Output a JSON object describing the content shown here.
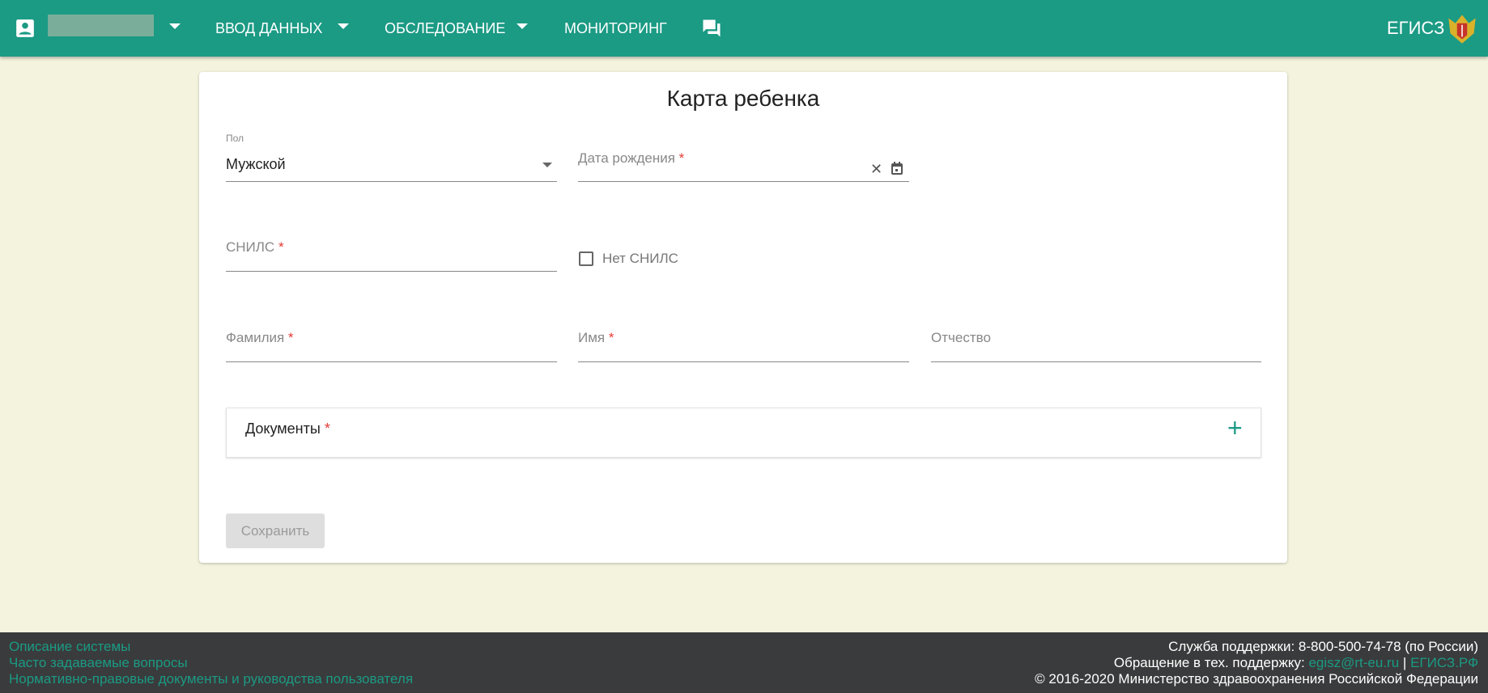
{
  "header": {
    "nav": [
      {
        "label": "ВВОД ДАННЫХ"
      },
      {
        "label": "ОБСЛЕДОВАНИЕ"
      },
      {
        "label": "МОНИТОРИНГ"
      }
    ],
    "brand": "ЕГИСЗ"
  },
  "form": {
    "title": "Карта ребенка",
    "gender": {
      "label": "Пол",
      "value": "Мужской"
    },
    "birth_date": {
      "label": "Дата рождения",
      "required": "*"
    },
    "snils": {
      "label": "СНИЛС",
      "required": "*"
    },
    "no_snils": {
      "label": "Нет СНИЛС",
      "checked": false
    },
    "last_name": {
      "label": "Фамилия",
      "required": "*"
    },
    "first_name": {
      "label": "Имя",
      "required": "*"
    },
    "middle_name": {
      "label": "Отчество"
    },
    "documents": {
      "label": "Документы",
      "required": "*"
    },
    "save_label": "Сохранить"
  },
  "footer": {
    "links": [
      "Описание системы",
      "Часто задаваемые вопросы",
      "Нормативно-правовые документы и руководства пользователя"
    ],
    "support": "Служба поддержки: 8-800-500-74-78 (по России)",
    "appeal": "Обращение в тех. поддержку:",
    "email": "egisz@rt-eu.ru",
    "sep": "|",
    "site": "ЕГИСЗ.РФ",
    "copyright": "© 2016-2020 Министерство здравоохранения Российской Федерации"
  },
  "colors": {
    "primary": "#1b9a84",
    "background": "#f4f4de",
    "footer": "#3a3b3c"
  }
}
